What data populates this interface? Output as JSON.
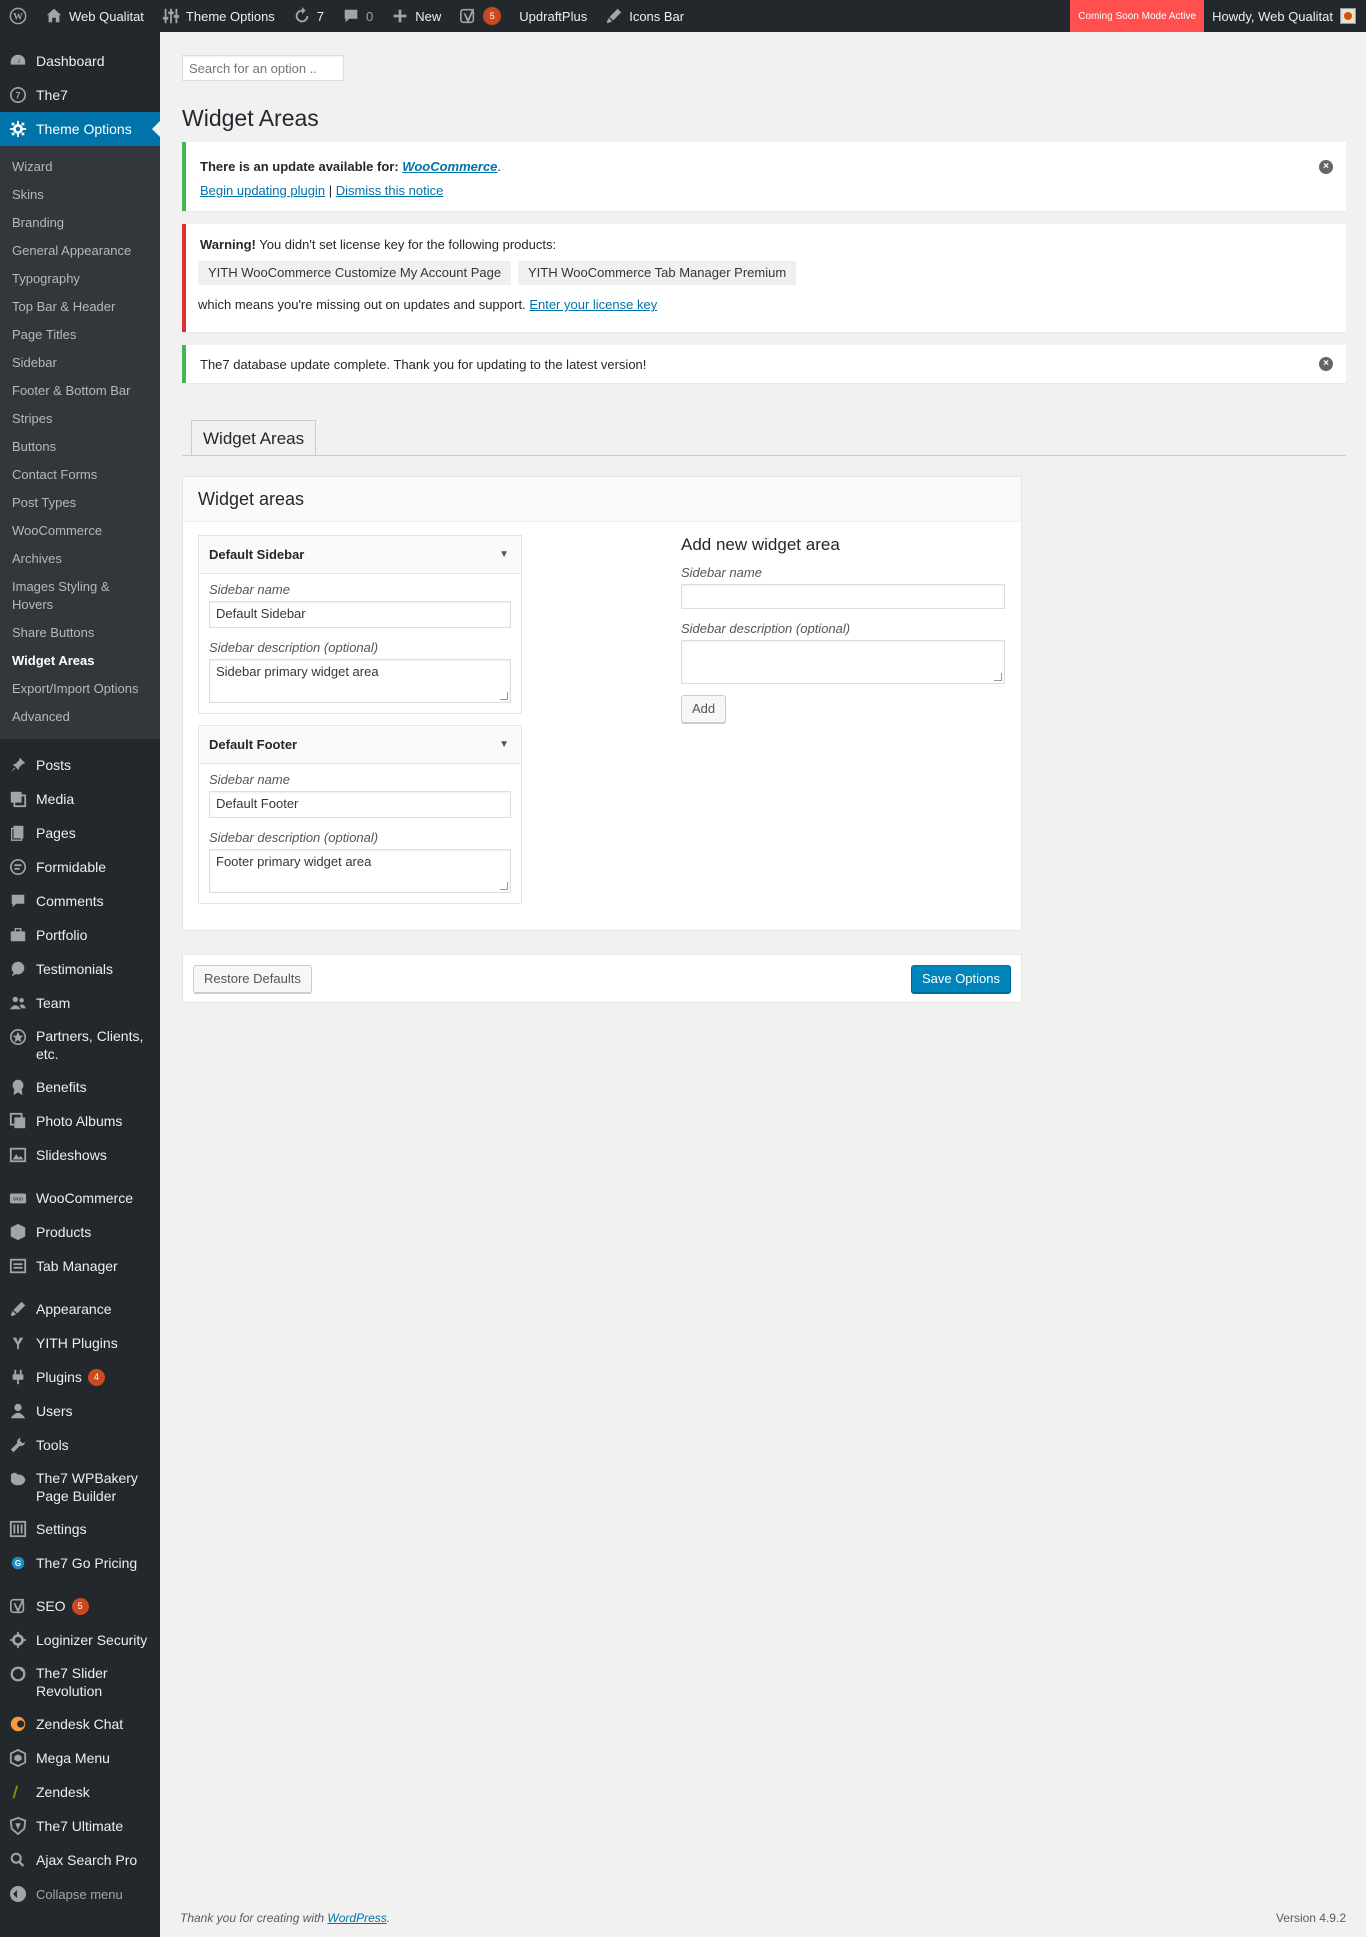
{
  "adminbar": {
    "site_name": "Web Qualitat",
    "theme_options": "Theme Options",
    "updates_count": "7",
    "comments_count": "0",
    "new_label": "New",
    "yoast_count": "5",
    "updraft": "UpdraftPlus",
    "icons_bar": "Icons Bar",
    "coming_soon": "Coming Soon Mode Active",
    "howdy": "Howdy, Web Qualitat"
  },
  "sidebar": {
    "top": [
      {
        "label": "Dashboard",
        "icon": "dashboard-icon"
      },
      {
        "label": "The7",
        "icon": "the7-icon"
      },
      {
        "label": "Theme Options",
        "icon": "gear-icon"
      }
    ],
    "submenu": [
      "Wizard",
      "Skins",
      "Branding",
      "General Appearance",
      "Typography",
      "Top Bar & Header",
      "Page Titles",
      "Sidebar",
      "Footer & Bottom Bar",
      "Stripes",
      "Buttons",
      "Contact Forms",
      "Post Types",
      "WooCommerce",
      "Archives",
      "Images Styling & Hovers",
      "Share Buttons",
      "Widget Areas",
      "Export/Import Options",
      "Advanced"
    ],
    "group1": [
      {
        "label": "Posts",
        "icon": "pin-icon"
      },
      {
        "label": "Media",
        "icon": "media-icon"
      },
      {
        "label": "Pages",
        "icon": "pages-icon"
      },
      {
        "label": "Formidable",
        "icon": "formidable-icon"
      },
      {
        "label": "Comments",
        "icon": "comments-icon"
      },
      {
        "label": "Portfolio",
        "icon": "portfolio-icon"
      },
      {
        "label": "Testimonials",
        "icon": "testimonials-icon"
      },
      {
        "label": "Team",
        "icon": "team-icon"
      },
      {
        "label": "Partners, Clients, etc.",
        "icon": "star-icon"
      },
      {
        "label": "Benefits",
        "icon": "award-icon"
      },
      {
        "label": "Photo Albums",
        "icon": "gallery-icon"
      },
      {
        "label": "Slideshows",
        "icon": "slideshow-icon"
      }
    ],
    "group2": [
      {
        "label": "WooCommerce",
        "icon": "woo-icon"
      },
      {
        "label": "Products",
        "icon": "products-icon"
      },
      {
        "label": "Tab Manager",
        "icon": "tab-manager-icon"
      }
    ],
    "group3": [
      {
        "label": "Appearance",
        "icon": "brush-icon"
      },
      {
        "label": "YITH Plugins",
        "icon": "yith-icon"
      },
      {
        "label": "Plugins",
        "icon": "plugins-icon",
        "badge": "4"
      },
      {
        "label": "Users",
        "icon": "users-icon"
      },
      {
        "label": "Tools",
        "icon": "tools-icon"
      },
      {
        "label": "The7 WPBakery Page Builder",
        "icon": "wpbakery-icon"
      },
      {
        "label": "Settings",
        "icon": "settings-icon"
      },
      {
        "label": "The7 Go Pricing",
        "icon": "go-pricing-icon"
      }
    ],
    "group4": [
      {
        "label": "SEO",
        "icon": "yoast-icon",
        "badge": "5"
      },
      {
        "label": "Loginizer Security",
        "icon": "loginizer-icon"
      },
      {
        "label": "The7 Slider Revolution",
        "icon": "revolution-icon"
      },
      {
        "label": "Zendesk Chat",
        "icon": "zendesk-chat-icon"
      },
      {
        "label": "Mega Menu",
        "icon": "mega-menu-icon"
      },
      {
        "label": "Zendesk",
        "icon": "zendesk-icon"
      },
      {
        "label": "The7 Ultimate",
        "icon": "ultimate-icon"
      },
      {
        "label": "Ajax Search Pro",
        "icon": "search-icon"
      }
    ],
    "collapse": "Collapse menu"
  },
  "search": {
    "placeholder": "Search for an option .."
  },
  "page_title": "Widget Areas",
  "notices": {
    "update_text": "There is an update available for:",
    "update_plugin": "WooCommerce",
    "begin_updating": "Begin updating plugin",
    "separator": "|",
    "dismiss": "Dismiss this notice",
    "warning_strong": "Warning!",
    "warning_text": "You didn't set license key for the following products:",
    "product1": "YITH WooCommerce Customize My Account Page",
    "product2": "YITH WooCommerce Tab Manager Premium",
    "missing_text": "which means you're missing out on updates and support.",
    "license_link": "Enter your license key",
    "db_complete": "The7 database update complete. Thank you for updating to the latest version!"
  },
  "tab_label": "Widget Areas",
  "panel": {
    "title": "Widget areas",
    "areas": [
      {
        "title": "Default Sidebar",
        "name_label": "Sidebar name",
        "name_value": "Default Sidebar",
        "desc_label": "Sidebar description (optional)",
        "desc_value": "Sidebar primary widget area"
      },
      {
        "title": "Default Footer",
        "name_label": "Sidebar name",
        "name_value": "Default Footer",
        "desc_label": "Sidebar description (optional)",
        "desc_value": "Footer primary widget area"
      }
    ],
    "new_area": {
      "title": "Add new widget area",
      "name_label": "Sidebar name",
      "name_value": "",
      "desc_label": "Sidebar description (optional)",
      "desc_value": "",
      "add_button": "Add"
    }
  },
  "buttons": {
    "restore": "Restore Defaults",
    "save": "Save Options"
  },
  "footer": {
    "thanks": "Thank you for creating with",
    "wp_link": "WordPress",
    "period": ".",
    "version": "Version 4.9.2"
  },
  "colors": {
    "accent": "#0073aa",
    "adminbar": "#23282d",
    "coming_soon": "#ff4f4f",
    "badge": "#ca4a1f",
    "primary_button": "#0085ba"
  }
}
